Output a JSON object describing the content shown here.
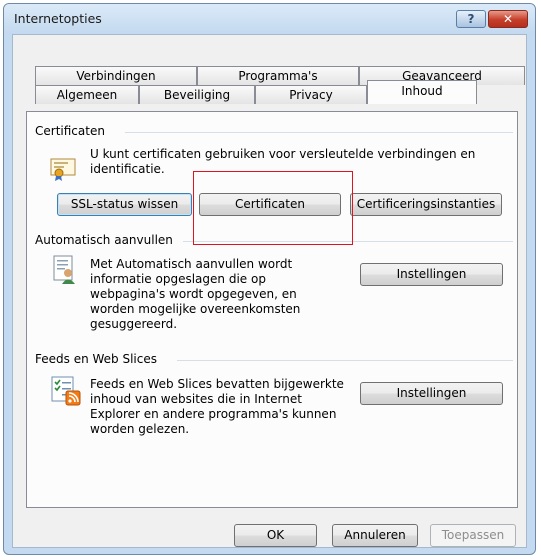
{
  "window": {
    "title": "Internetopties",
    "help_glyph": "?",
    "close_glyph": "✕"
  },
  "tabs": {
    "row1": [
      "Verbindingen",
      "Programma's",
      "Geavanceerd"
    ],
    "row2": [
      "Algemeen",
      "Beveiliging",
      "Privacy",
      "Inhoud"
    ],
    "active": "Inhoud"
  },
  "certificates": {
    "group_title": "Certificaten",
    "icon": "certificate-icon",
    "description": "U kunt certificaten gebruiken voor versleutelde verbindingen en identificatie.",
    "ssl_button": "SSL-status wissen",
    "certificates_button": "Certificaten",
    "publishers_button": "Certificeringsinstanties"
  },
  "autocomplete": {
    "group_title": "Automatisch aanvullen",
    "icon": "autocomplete-icon",
    "description": "Met Automatisch aanvullen wordt informatie opgeslagen die op webpagina's wordt opgegeven, en worden mogelijke overeenkomsten gesuggereerd.",
    "settings_button": "Instellingen"
  },
  "feeds": {
    "group_title": "Feeds en Web Slices",
    "icon": "feeds-icon",
    "description": "Feeds en Web Slices bevatten bijgewerkte inhoud van websites die in Internet Explorer en andere programma's kunnen worden gelezen.",
    "settings_button": "Instellingen"
  },
  "footer": {
    "ok": "OK",
    "cancel": "Annuleren",
    "apply": "Toepassen"
  },
  "colors": {
    "highlight": "#e0141e",
    "titlebar": "#c4daf0"
  }
}
